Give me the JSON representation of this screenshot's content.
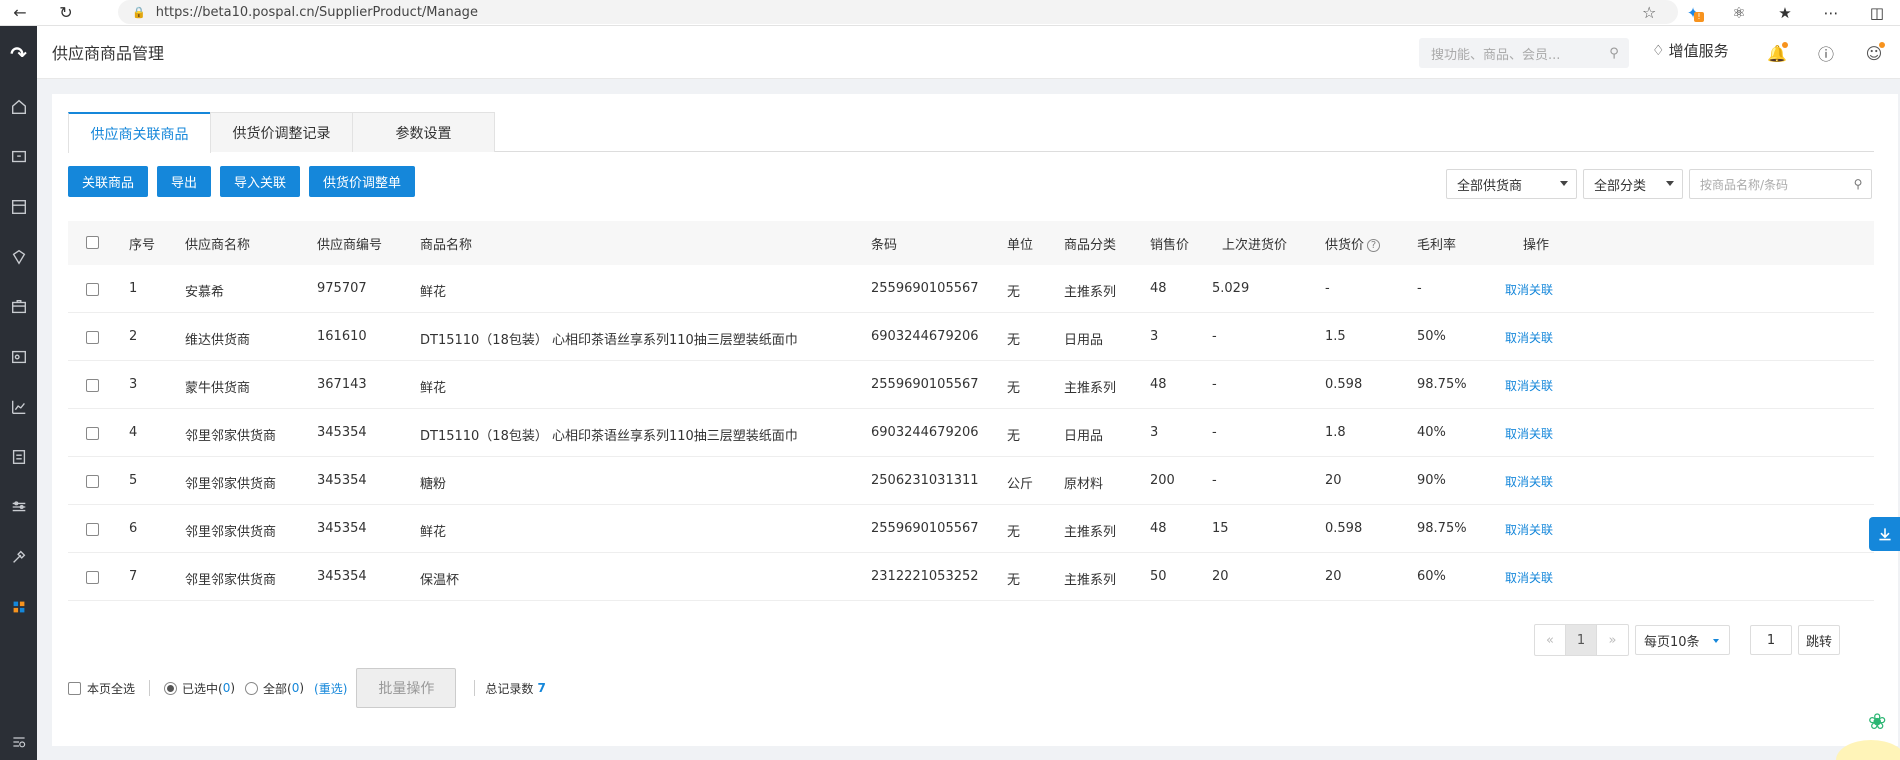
{
  "browser": {
    "url": "https://beta10.pospal.cn/SupplierProduct/Manage",
    "ext_badge": "!"
  },
  "header": {
    "title": "供应商商品管理",
    "search_placeholder": "搜功能、商品、会员...",
    "value_added_services": "增值服务"
  },
  "tabs": [
    {
      "label": "供应商关联商品",
      "active": true
    },
    {
      "label": "供货价调整记录",
      "active": false
    },
    {
      "label": "参数设置",
      "active": false
    }
  ],
  "actions": {
    "link_products": "关联商品",
    "export": "导出",
    "import_link": "导入关联",
    "price_adjust": "供货价调整单"
  },
  "filters": {
    "supplier": "全部供货商",
    "category": "全部分类",
    "search_placeholder": "按商品名称/条码"
  },
  "table": {
    "headers": {
      "index": "序号",
      "supplier_name": "供应商名称",
      "supplier_code": "供应商编号",
      "product_name": "商品名称",
      "barcode": "条码",
      "unit": "单位",
      "category": "商品分类",
      "sale_price": "销售价",
      "last_purchase_price": "上次进货价",
      "supply_price": "供货价",
      "margin": "毛利率",
      "operation": "操作"
    },
    "help_glyph": "?",
    "rows": [
      {
        "index": "1",
        "supplier_name": "安慕希",
        "supplier_code": "975707",
        "product_name": "鲜花",
        "barcode": "2559690105567",
        "unit": "无",
        "category": "主推系列",
        "sale_price": "48",
        "last_purchase_price": "5.029",
        "supply_price": "-",
        "margin": "-",
        "action": "取消关联"
      },
      {
        "index": "2",
        "supplier_name": "维达供货商",
        "supplier_code": "161610",
        "product_name": "DT15110（18包装） 心相印茶语丝享系列110抽三层塑装纸面巾",
        "barcode": "6903244679206",
        "unit": "无",
        "category": "日用品",
        "sale_price": "3",
        "last_purchase_price": "-",
        "supply_price": "1.5",
        "margin": "50%",
        "action": "取消关联"
      },
      {
        "index": "3",
        "supplier_name": "蒙牛供货商",
        "supplier_code": "367143",
        "product_name": "鲜花",
        "barcode": "2559690105567",
        "unit": "无",
        "category": "主推系列",
        "sale_price": "48",
        "last_purchase_price": "-",
        "supply_price": "0.598",
        "margin": "98.75%",
        "action": "取消关联"
      },
      {
        "index": "4",
        "supplier_name": "邻里邻家供货商",
        "supplier_code": "345354",
        "product_name": "DT15110（18包装） 心相印茶语丝享系列110抽三层塑装纸面巾",
        "barcode": "6903244679206",
        "unit": "无",
        "category": "日用品",
        "sale_price": "3",
        "last_purchase_price": "-",
        "supply_price": "1.8",
        "margin": "40%",
        "action": "取消关联"
      },
      {
        "index": "5",
        "supplier_name": "邻里邻家供货商",
        "supplier_code": "345354",
        "product_name": "糖粉",
        "barcode": "2506231031311",
        "unit": "公斤",
        "category": "原材料",
        "sale_price": "200",
        "last_purchase_price": "-",
        "supply_price": "20",
        "margin": "90%",
        "action": "取消关联"
      },
      {
        "index": "6",
        "supplier_name": "邻里邻家供货商",
        "supplier_code": "345354",
        "product_name": "鲜花",
        "barcode": "2559690105567",
        "unit": "无",
        "category": "主推系列",
        "sale_price": "48",
        "last_purchase_price": "15",
        "supply_price": "0.598",
        "margin": "98.75%",
        "action": "取消关联"
      },
      {
        "index": "7",
        "supplier_name": "邻里邻家供货商",
        "supplier_code": "345354",
        "product_name": "保温杯",
        "barcode": "2312221053252",
        "unit": "无",
        "category": "主推系列",
        "sale_price": "50",
        "last_purchase_price": "20",
        "supply_price": "20",
        "margin": "60%",
        "action": "取消关联"
      }
    ]
  },
  "pagination": {
    "prev": "«",
    "current": "1",
    "next": "»",
    "page_size": "每页10条",
    "jump_value": "1",
    "jump_label": "跳转"
  },
  "footer": {
    "select_page": "本页全选",
    "selected_label": "已选中(",
    "selected_count": "0",
    "all_label": "全部(",
    "all_count": "0",
    "close_paren": ")",
    "reselect": "(重选)",
    "batch": "批量操作",
    "total_label": "总记录数",
    "total_value": "7"
  }
}
